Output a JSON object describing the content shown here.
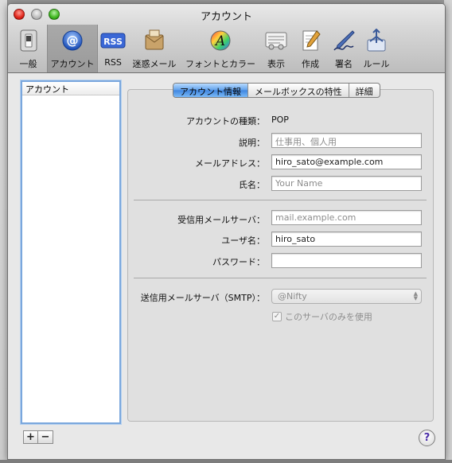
{
  "window": {
    "title": "アカウント"
  },
  "toolbar": {
    "items": [
      {
        "label": "一般",
        "icon": "switch-icon"
      },
      {
        "label": "アカウント",
        "icon": "at-icon"
      },
      {
        "label": "RSS",
        "icon": "rss-icon"
      },
      {
        "label": "迷惑メール",
        "icon": "junk-mail-icon"
      },
      {
        "label": "フォントとカラー",
        "icon": "font-icon"
      },
      {
        "label": "表示",
        "icon": "display-icon"
      },
      {
        "label": "作成",
        "icon": "compose-icon"
      },
      {
        "label": "署名",
        "icon": "signature-icon"
      },
      {
        "label": "ルール",
        "icon": "rules-icon"
      }
    ],
    "selected": "アカウント"
  },
  "sidebar": {
    "header": "アカウント",
    "add_label": "+",
    "remove_label": "−"
  },
  "tabs": [
    {
      "label": "アカウント情報",
      "active": true
    },
    {
      "label": "メールボックスの特性",
      "active": false
    },
    {
      "label": "詳細",
      "active": false
    }
  ],
  "form": {
    "account_type_label": "アカウントの種類：",
    "account_type_value": "POP",
    "description_label": "説明：",
    "description_placeholder": "仕事用、個人用",
    "email_label": "メールアドレス：",
    "email_value": "hiro_sato@example.com",
    "name_label": "氏名：",
    "name_placeholder": "Your Name",
    "incoming_server_label": "受信用メールサーバ：",
    "incoming_server_value": "mail.example.com",
    "username_label": "ユーザ名：",
    "username_value": "hiro_sato",
    "password_label": "パスワード：",
    "password_value": "",
    "smtp_label": "送信用メールサーバ（SMTP）：",
    "smtp_value": "@Nifty",
    "only_this_server_label": "このサーバのみを使用",
    "only_this_server_checked": true
  },
  "help": {
    "label": "?"
  },
  "colors": {
    "selected_tab": "#3f86e0",
    "list_focus": "#7aa7dd"
  }
}
